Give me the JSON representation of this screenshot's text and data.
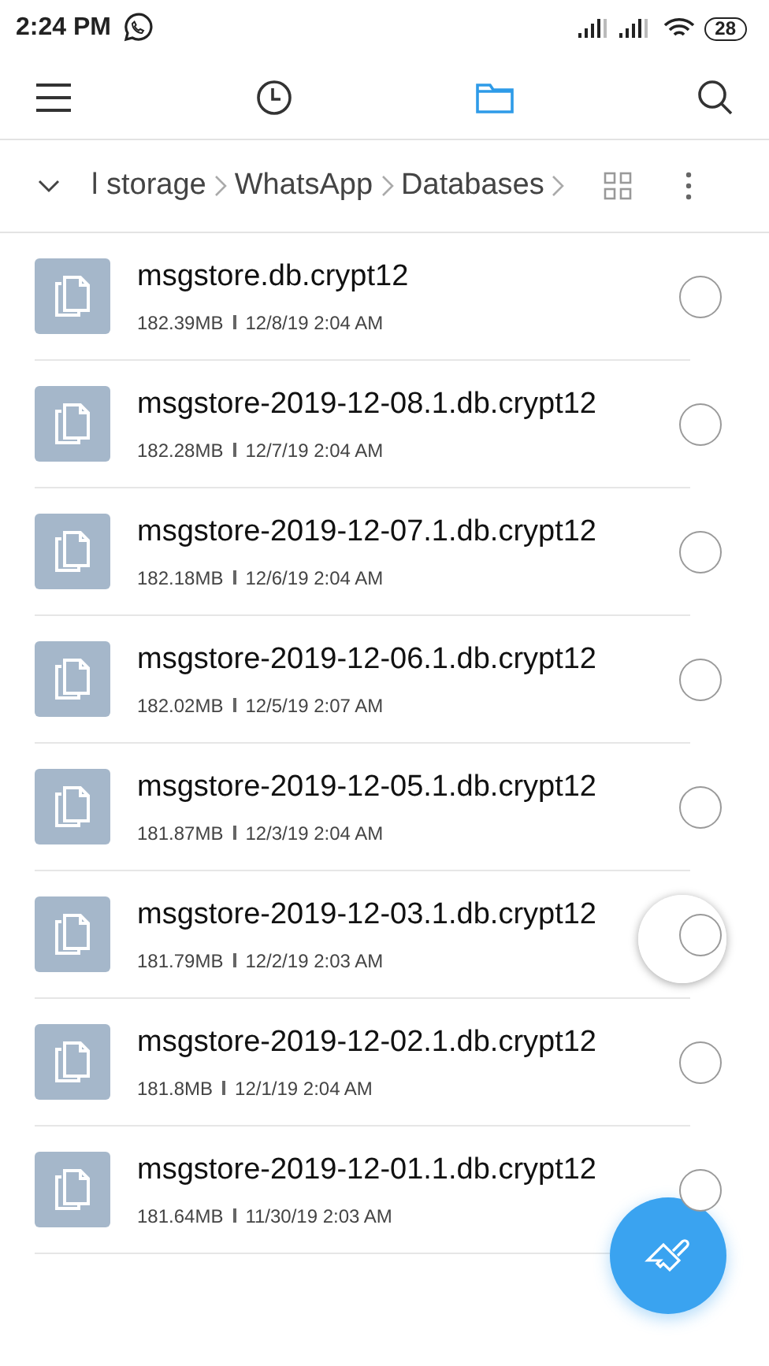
{
  "status_bar": {
    "time": "2:24 PM",
    "battery": "28"
  },
  "toolbar": {
    "tabs": [
      {
        "kind": "recent",
        "selected": false
      },
      {
        "kind": "folder",
        "selected": true
      }
    ]
  },
  "breadcrumb": {
    "items": [
      "l storage",
      "WhatsApp",
      "Databases"
    ]
  },
  "files": [
    {
      "name": "msgstore.db.crypt12",
      "size": "182.39MB",
      "date": "12/8/19 2:04 AM",
      "selected": false
    },
    {
      "name": "msgstore-2019-12-08.1.db.crypt12",
      "size": "182.28MB",
      "date": "12/7/19 2:04 AM",
      "selected": false
    },
    {
      "name": "msgstore-2019-12-07.1.db.crypt12",
      "size": "182.18MB",
      "date": "12/6/19 2:04 AM",
      "selected": false
    },
    {
      "name": "msgstore-2019-12-06.1.db.crypt12",
      "size": "182.02MB",
      "date": "12/5/19 2:07 AM",
      "selected": false
    },
    {
      "name": "msgstore-2019-12-05.1.db.crypt12",
      "size": "181.87MB",
      "date": "12/3/19 2:04 AM",
      "selected": false
    },
    {
      "name": "msgstore-2019-12-03.1.db.crypt12",
      "size": "181.79MB",
      "date": "12/2/19 2:03 AM",
      "selected": false
    },
    {
      "name": "msgstore-2019-12-02.1.db.crypt12",
      "size": "181.8MB",
      "date": "12/1/19 2:04 AM",
      "selected": false
    },
    {
      "name": "msgstore-2019-12-01.1.db.crypt12",
      "size": "181.64MB",
      "date": "11/30/19 2:03 AM",
      "selected": false
    }
  ]
}
